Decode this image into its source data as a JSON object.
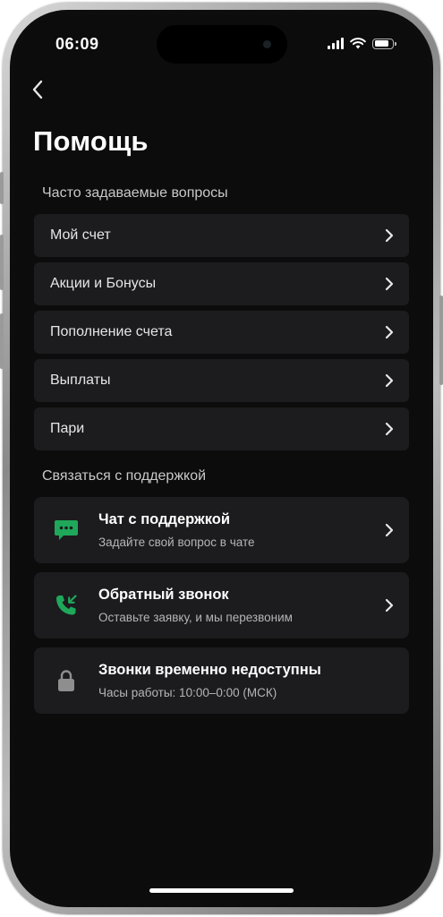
{
  "status_bar": {
    "time": "06:09"
  },
  "header": {
    "title": "Помощь"
  },
  "faq": {
    "section_title": "Часто задаваемые вопросы",
    "items": [
      {
        "label": "Мой счет"
      },
      {
        "label": "Акции и Бонусы"
      },
      {
        "label": "Пополнение счета"
      },
      {
        "label": "Выплаты"
      },
      {
        "label": "Пари"
      }
    ]
  },
  "support": {
    "section_title": "Связаться с поддержкой",
    "items": [
      {
        "title": "Чат с поддержкой",
        "subtitle": "Задайте свой вопрос в чате",
        "icon": "chat-icon",
        "enabled": true
      },
      {
        "title": "Обратный звонок",
        "subtitle": "Оставьте заявку, и мы перезвоним",
        "icon": "phone-callback-icon",
        "enabled": true
      },
      {
        "title": "Звонки временно недоступны",
        "subtitle": "Часы работы: 10:00–0:00 (МСК)",
        "icon": "lock-icon",
        "enabled": false
      }
    ]
  },
  "colors": {
    "background": "#0c0c0c",
    "card": "#1c1c1f",
    "accent_green": "#1fa85a",
    "muted_icon": "#8e8e8e"
  }
}
